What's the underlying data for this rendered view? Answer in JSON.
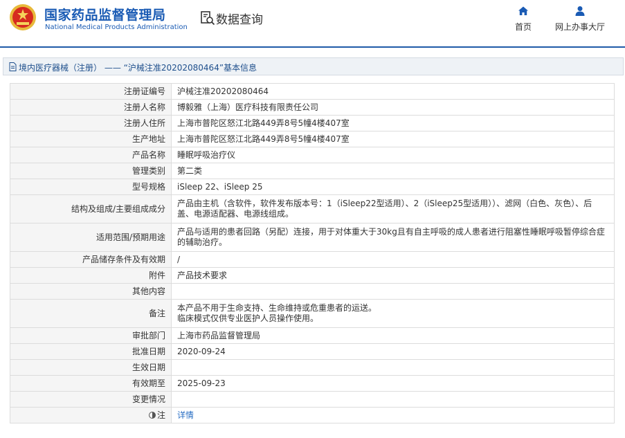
{
  "header": {
    "site_title_cn": "国家药品监督管理局",
    "site_title_en": "National Medical Products Administration",
    "section_title": "数据查询",
    "nav": [
      {
        "label": "首页",
        "icon": "home-icon"
      },
      {
        "label": "网上办事大厅",
        "icon": "user-icon"
      }
    ],
    "brand_color": "#1a5bb4",
    "accent_line": "#1e5aa8"
  },
  "breadcrumb": {
    "text": "境内医疗器械（注册） —— “沪械注准20202080464”基本信息",
    "icon": "document-icon"
  },
  "details": [
    {
      "label": "注册证编号",
      "value": "沪械注准20202080464"
    },
    {
      "label": "注册人名称",
      "value": "博毅雅（上海）医疗科技有限责任公司"
    },
    {
      "label": "注册人住所",
      "value": "上海市普陀区怒江北路449弄8号5幢4楼407室"
    },
    {
      "label": "生产地址",
      "value": "上海市普陀区怒江北路449弄8号5幢4楼407室"
    },
    {
      "label": "产品名称",
      "value": "睡眠呼吸治疗仪"
    },
    {
      "label": "管理类别",
      "value": "第二类"
    },
    {
      "label": "型号规格",
      "value": "iSleep 22、iSleep 25"
    },
    {
      "label": "结构及组成/主要组成成分",
      "value": "产品由主机（含软件，软件发布版本号：1（iSleep22型适用）、2（iSleep25型适用））、滤网（白色、灰色）、后盖、电源适配器、电源线组成。"
    },
    {
      "label": "适用范围/预期用途",
      "value": "产品与适用的患者回路（另配）连接，用于对体重大于30kg且有自主呼吸的成人患者进行阻塞性睡眠呼吸暂停综合症的辅助治疗。"
    },
    {
      "label": "产品储存条件及有效期",
      "value": "/"
    },
    {
      "label": "附件",
      "value": "产品技术要求"
    },
    {
      "label": "其他内容",
      "value": ""
    },
    {
      "label": "备注",
      "value_lines": [
        "本产品不用于生命支持、生命维持或危重患者的运送。",
        "临床模式仅供专业医护人员操作使用。"
      ]
    },
    {
      "label": "审批部门",
      "value": "上海市药品监督管理局"
    },
    {
      "label": "批准日期",
      "value": "2020-09-24"
    },
    {
      "label": "生效日期",
      "value": ""
    },
    {
      "label": "有效期至",
      "value": "2025-09-23"
    },
    {
      "label": "变更情况",
      "value": ""
    },
    {
      "label": "注",
      "value": "详情",
      "icon": "note-icon"
    }
  ]
}
